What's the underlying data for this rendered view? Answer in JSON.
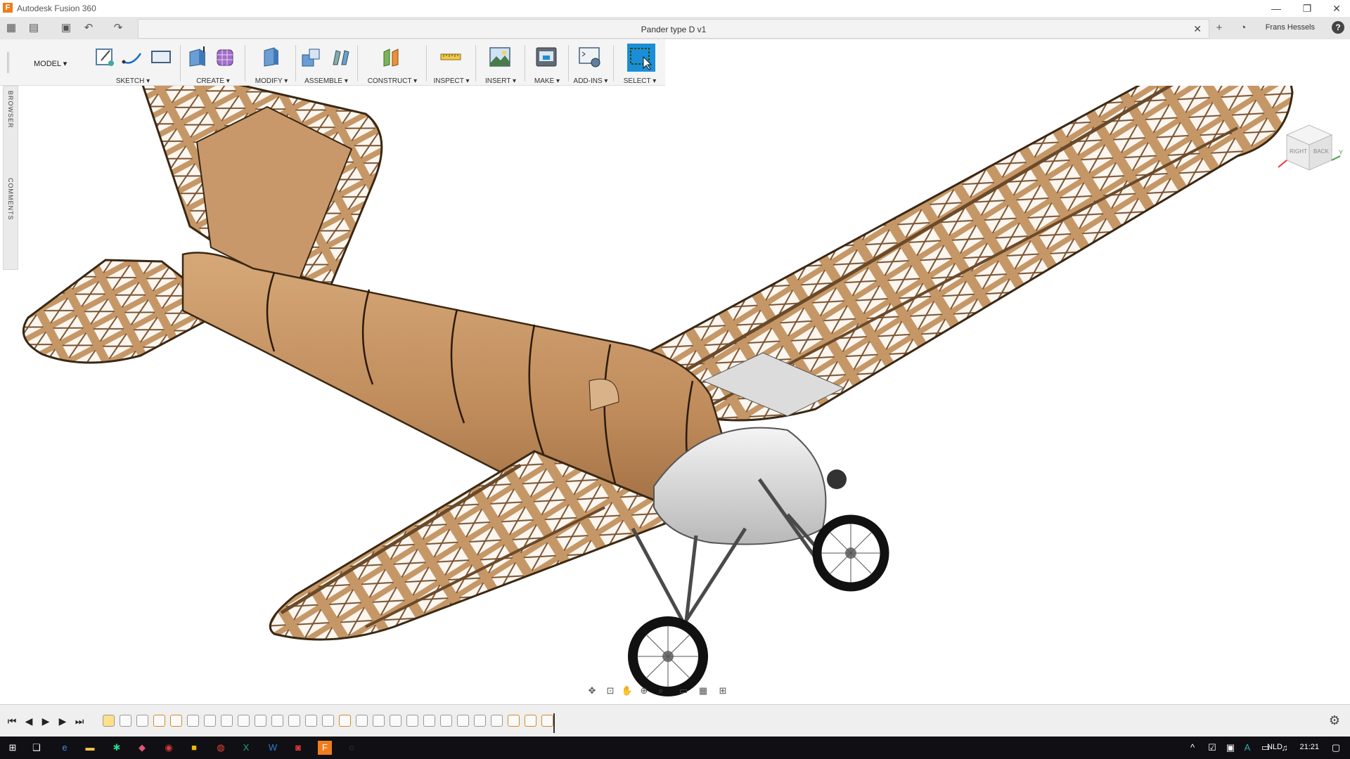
{
  "window": {
    "app_title": "Autodesk Fusion 360",
    "logo_letter": "F",
    "minimize": "—",
    "restore": "❐",
    "close": "✕"
  },
  "quickbar": {
    "document_title": "Pander type D v1",
    "doc_close": "✕",
    "user_name": "Frans Hessels",
    "help": "?"
  },
  "toolbar": {
    "workspace": "MODEL ▾",
    "groups": [
      {
        "label": "SKETCH ▾"
      },
      {
        "label": "CREATE ▾"
      },
      {
        "label": "MODIFY ▾"
      },
      {
        "label": "ASSEMBLE ▾"
      },
      {
        "label": "CONSTRUCT ▾"
      },
      {
        "label": "INSPECT ▾"
      },
      {
        "label": "INSERT ▾"
      },
      {
        "label": "MAKE ▾"
      },
      {
        "label": "ADD-INS ▾"
      },
      {
        "label": "SELECT ▾"
      }
    ]
  },
  "left_panel": {
    "browser": "BROWSER",
    "comments": "COMMENTS"
  },
  "viewcube": {
    "right": "RIGHT",
    "back": "BACK",
    "y_axis": "Y"
  },
  "taskbar": {
    "language": "NLD",
    "time": "21:21"
  },
  "colors": {
    "accent": "#1b8ed8",
    "fusion_orange": "#f07d1b",
    "wood": "#c99a6b",
    "wood_dark": "#a8764a"
  }
}
